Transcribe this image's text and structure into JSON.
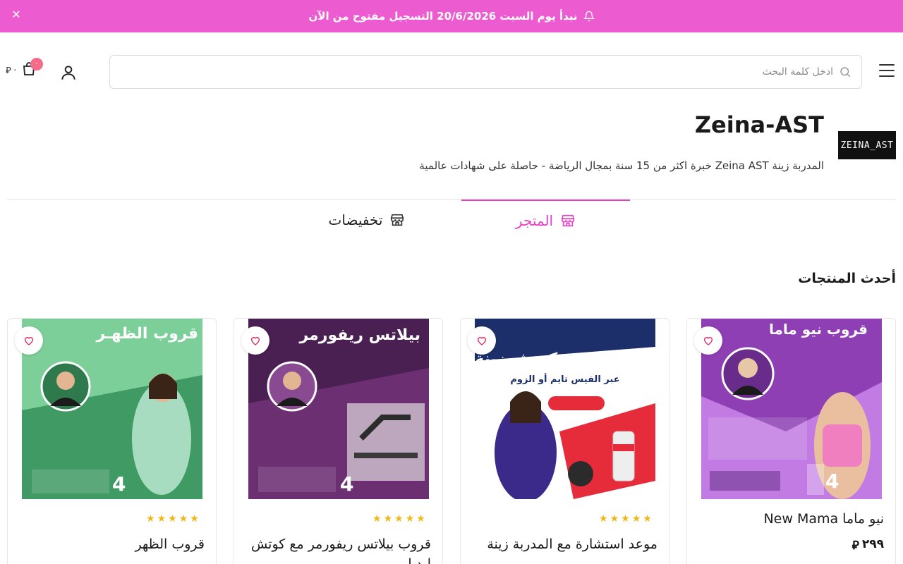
{
  "announcement": {
    "text": "نبدأ يوم السبت 20/6/2026 التسجيل مفتوح من الآن",
    "bg_color": "#ec5bcf",
    "close_icon": "close-icon"
  },
  "header": {
    "search_placeholder": "ادخل كلمة البحث",
    "cart_count": "٠",
    "cart_amount": "٠",
    "currency_symbol": "⃁"
  },
  "store": {
    "logo_text": "ZEINA_AST",
    "title": "Zeina-AST",
    "description": "المدربة زينة Zeina AST خبرة اكثر من 15 سنة بمجال الرياضة - حاصلة على شهادات عالمية"
  },
  "tabs": [
    {
      "label": "المتجر",
      "icon": "store-icon",
      "active": true
    },
    {
      "label": "تخفيضات",
      "icon": "store-icon",
      "active": false
    }
  ],
  "section": {
    "title": "أحدث المنتجات"
  },
  "accent_color": "#e640c3",
  "products": [
    {
      "name": "نيو ماما New Mama",
      "price": "٢٩٩",
      "rating": 0,
      "image_heading": "قروب نيو ماما",
      "image_bg": "#c27be3",
      "image_accent": "#ffffff"
    },
    {
      "name": "موعد استشارة مع المدربة زينة",
      "price": "",
      "rating": 5,
      "image_heading": "استشارة مع كوتش زينة",
      "image_sub": "عبر الفيس تايم أو الزوم",
      "image_bg": "#1d2f6b",
      "image_accent": "#e62b3a"
    },
    {
      "name": "قروب بيلاتس ريفورمر مع كوتش ليديا",
      "price": "",
      "rating": 5,
      "image_heading": "بيلاتس ريفورمر",
      "image_bg": "#6b2f72",
      "image_accent": "#ffffff"
    },
    {
      "name": "قروب الظهر",
      "price": "",
      "rating": 5,
      "image_heading": "قروب الظهـر",
      "image_bg": "#3f9a63",
      "image_accent": "#ffffff"
    }
  ]
}
